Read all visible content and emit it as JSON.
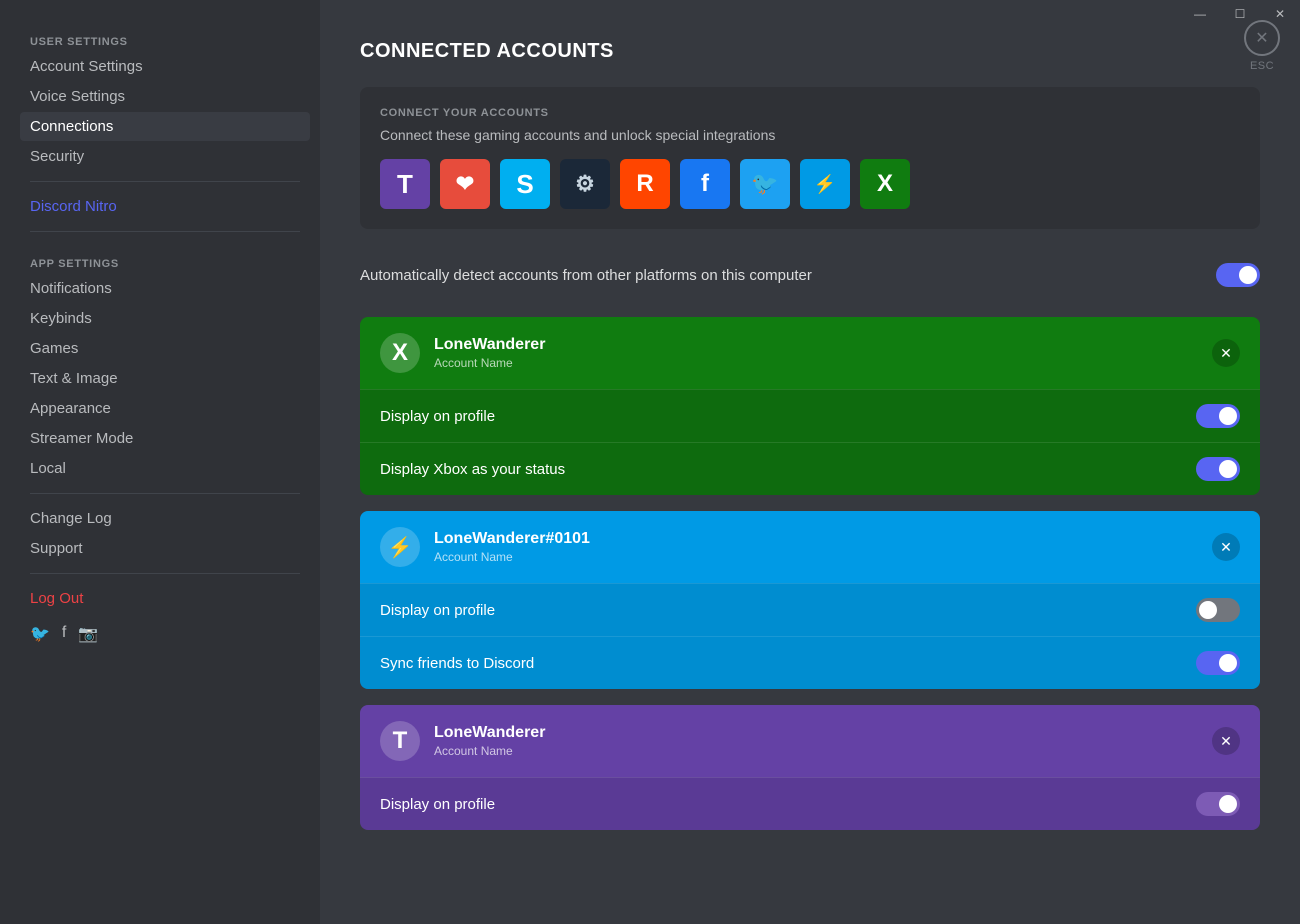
{
  "window": {
    "minimize": "—",
    "maximize": "☐",
    "close": "✕"
  },
  "sidebar": {
    "user_settings_label": "USER SETTINGS",
    "app_settings_label": "APP SETTINGS",
    "items_user": [
      {
        "id": "account-settings",
        "label": "Account Settings",
        "active": false
      },
      {
        "id": "voice-settings",
        "label": "Voice Settings",
        "active": false
      },
      {
        "id": "connections",
        "label": "Connections",
        "active": true
      },
      {
        "id": "security",
        "label": "Security",
        "active": false
      }
    ],
    "nitro": {
      "id": "discord-nitro",
      "label": "Discord Nitro"
    },
    "items_app": [
      {
        "id": "notifications",
        "label": "Notifications",
        "active": false
      },
      {
        "id": "keybinds",
        "label": "Keybinds",
        "active": false
      },
      {
        "id": "games",
        "label": "Games",
        "active": false
      },
      {
        "id": "text-image",
        "label": "Text & Image",
        "active": false
      },
      {
        "id": "appearance",
        "label": "Appearance",
        "active": false
      },
      {
        "id": "streamer-mode",
        "label": "Streamer Mode",
        "active": false
      },
      {
        "id": "local",
        "label": "Local",
        "active": false
      }
    ],
    "other": [
      {
        "id": "change-log",
        "label": "Change Log"
      },
      {
        "id": "support",
        "label": "Support"
      }
    ],
    "logout": "Log Out",
    "social": [
      "𝕏",
      "f",
      "📷"
    ]
  },
  "main": {
    "title": "CONNECTED ACCOUNTS",
    "connect_section": {
      "label": "CONNECT YOUR ACCOUNTS",
      "description": "Connect these gaming accounts and unlock special integrations"
    },
    "platforms": [
      {
        "id": "twitch",
        "bg": "#6441a5",
        "symbol": "T",
        "color": "#fff"
      },
      {
        "id": "amazon",
        "bg": "#e74c3c",
        "symbol": "❤",
        "color": "#fff"
      },
      {
        "id": "skype",
        "bg": "#00aff0",
        "symbol": "S",
        "color": "#fff"
      },
      {
        "id": "steam",
        "bg": "#1b2838",
        "symbol": "⚙",
        "color": "#fff"
      },
      {
        "id": "reddit",
        "bg": "#ff4500",
        "symbol": "R",
        "color": "#fff"
      },
      {
        "id": "facebook",
        "bg": "#1877f2",
        "symbol": "f",
        "color": "#fff"
      },
      {
        "id": "twitter",
        "bg": "#1da1f2",
        "symbol": "🐦",
        "color": "#fff"
      },
      {
        "id": "battlenet",
        "bg": "#009ae5",
        "symbol": "⚡",
        "color": "#fff"
      },
      {
        "id": "xbox",
        "bg": "#107c10",
        "symbol": "X",
        "color": "#fff"
      }
    ],
    "auto_detect": {
      "label": "Automatically detect accounts from other platforms on this computer",
      "enabled": true
    },
    "accounts": [
      {
        "id": "xbox-account",
        "type": "xbox",
        "theme": "card-xbox",
        "icon": "X",
        "icon_bg": "#107c10",
        "username": "LoneWanderer",
        "account_name_label": "Account Name",
        "rows": [
          {
            "label": "Display on profile",
            "enabled": true
          },
          {
            "label": "Display Xbox as your status",
            "enabled": true
          }
        ]
      },
      {
        "id": "battlenet-account",
        "type": "battlenet",
        "theme": "card-battlenet",
        "icon": "⚡",
        "icon_bg": "#009ae5",
        "username": "LoneWanderer#0101",
        "account_name_label": "Account Name",
        "rows": [
          {
            "label": "Display on profile",
            "enabled": false
          },
          {
            "label": "Sync friends to Discord",
            "enabled": true
          }
        ]
      },
      {
        "id": "twitch-account",
        "type": "twitch",
        "theme": "card-twitch",
        "icon": "T",
        "icon_bg": "#6441a5",
        "username": "LoneWanderer",
        "account_name_label": "Account Name",
        "rows": [
          {
            "label": "Display on profile",
            "enabled": true
          }
        ]
      }
    ],
    "close_label": "ESC"
  }
}
